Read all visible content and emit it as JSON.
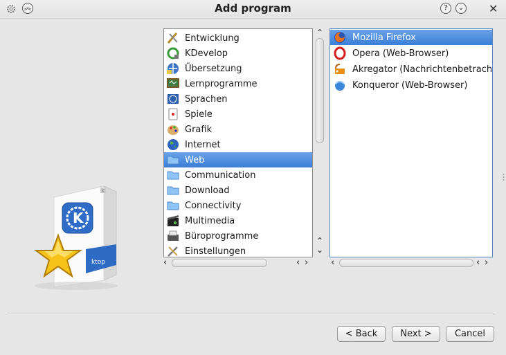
{
  "window": {
    "title": "Add program"
  },
  "categories": [
    {
      "label": "Entwicklung",
      "icon": "development-icon"
    },
    {
      "label": "KDevelop",
      "icon": "kdevelop-icon"
    },
    {
      "label": "Übersetzung",
      "icon": "translation-icon"
    },
    {
      "label": "Lernprogramme",
      "icon": "education-icon"
    },
    {
      "label": "Sprachen",
      "icon": "languages-icon"
    },
    {
      "label": "Spiele",
      "icon": "games-icon"
    },
    {
      "label": "Grafik",
      "icon": "graphics-icon"
    },
    {
      "label": "Internet",
      "icon": "internet-globe-icon"
    },
    {
      "label": "Web",
      "icon": "folder-icon"
    },
    {
      "label": "Communication",
      "icon": "folder-icon"
    },
    {
      "label": "Download",
      "icon": "folder-icon"
    },
    {
      "label": "Connectivity",
      "icon": "folder-icon"
    },
    {
      "label": "Multimedia",
      "icon": "multimedia-icon"
    },
    {
      "label": "Büroprogramme",
      "icon": "office-icon"
    },
    {
      "label": "Einstellungen",
      "icon": "settings-icon"
    }
  ],
  "selected_category": "Web",
  "apps": [
    {
      "label": "Mozilla Firefox",
      "icon": "firefox-icon"
    },
    {
      "label": "Opera (Web-Browser)",
      "icon": "opera-icon"
    },
    {
      "label": "Akregator (Nachrichtenbetrachter)",
      "icon": "akregator-icon"
    },
    {
      "label": "Konqueror (Web-Browser)",
      "icon": "konqueror-icon"
    }
  ],
  "selected_app": "Mozilla Firefox",
  "illustration": {
    "box_text": "ktop",
    "brand_letter": "K"
  },
  "buttons": {
    "back": "< Back",
    "next": "Next >",
    "cancel": "Cancel"
  },
  "colors": {
    "selection": "#3b7fd8",
    "folder": "#6fb0f0"
  }
}
